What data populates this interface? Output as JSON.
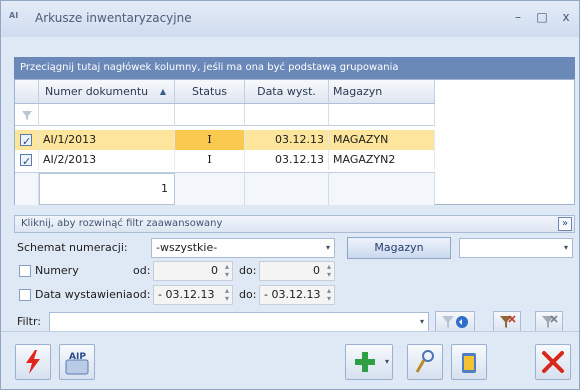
{
  "window": {
    "icon_text": "AI",
    "title": "Arkusze inwentaryzacyjne",
    "minimize": "–",
    "maximize": "□",
    "close": "x"
  },
  "grid": {
    "group_hint": "Przeciągnij tutaj nagłówek kolumny, jeśli ma ona być podstawą grupowania",
    "columns": [
      "Numer dokumentu",
      "Status",
      "Data wyst.",
      "Magazyn"
    ],
    "sort_indicator": "▲",
    "rows": [
      {
        "checked": true,
        "numer": "AI/1/2013",
        "status": "I",
        "data": "03.12.13",
        "magazyn": "MAGAZYN",
        "selected": true
      },
      {
        "checked": true,
        "numer": "AI/2/2013",
        "status": "I",
        "data": "03.12.13",
        "magazyn": "MAGAZYN2",
        "selected": false
      }
    ],
    "summary_count": "1"
  },
  "filter": {
    "advanced_hint": "Kliknij, aby rozwinąć filtr zaawansowany",
    "expand_icon": "»",
    "schemat_label": "Schemat numeracji:",
    "schemat_value": "-wszystkie-",
    "magazyn_button": "Magazyn",
    "magazyn_value": "",
    "numery_label": "Numery",
    "od_label": "od:",
    "do_label": "do:",
    "numery_od": "0",
    "numery_do": "0",
    "data_label": "Data wystawienia",
    "data_od": "- 03.12.13",
    "data_do": "- 03.12.13",
    "filtr_label": "Filtr:",
    "filtr_value": ""
  },
  "toolbar": {
    "icons": [
      "lightning-icon",
      "aip-icon",
      "add-icon",
      "edit-icon",
      "delete-icon",
      "close-icon"
    ]
  },
  "colors": {
    "accent": "#6a88b8",
    "selected_row": "#fde59b",
    "add_green": "#2ea043",
    "close_red": "#d9261c"
  }
}
